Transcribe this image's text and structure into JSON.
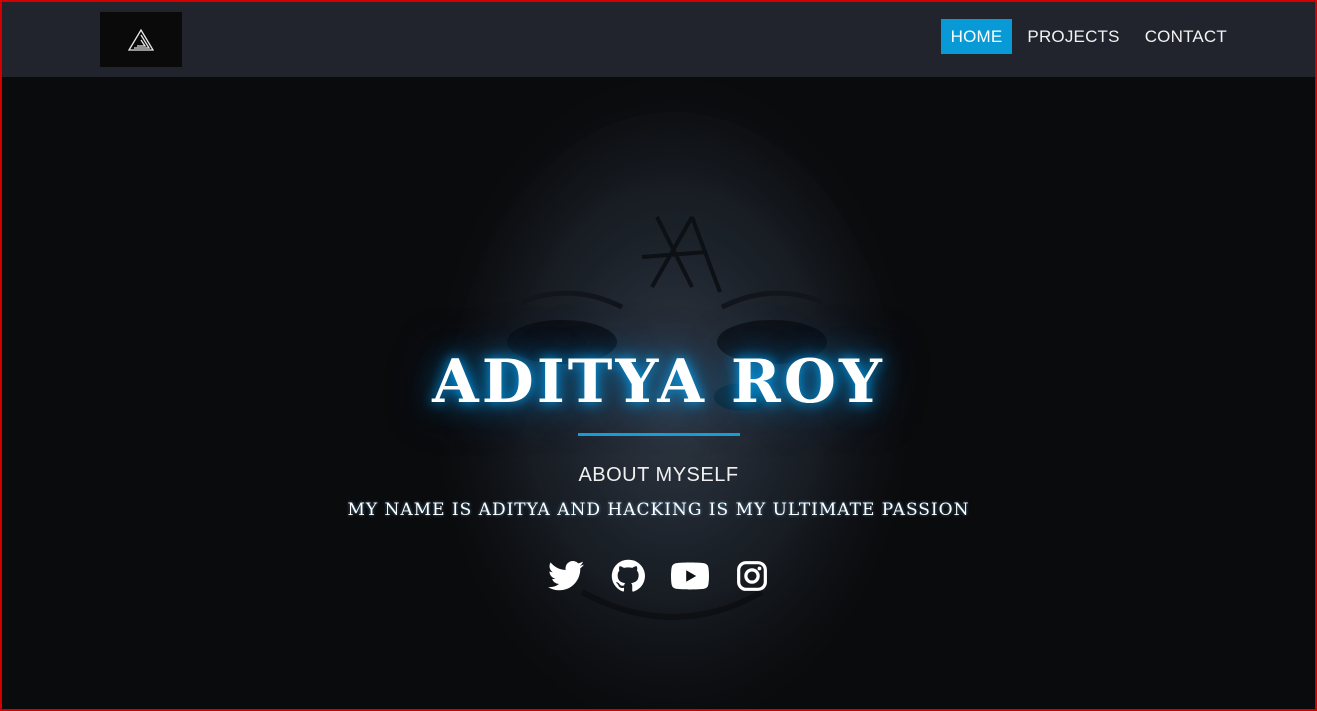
{
  "nav": {
    "items": [
      {
        "label": "HOME",
        "active": true
      },
      {
        "label": "PROJECTS",
        "active": false
      },
      {
        "label": "CONTACT",
        "active": false
      }
    ]
  },
  "logo": {
    "icon": "triangle-a-logo-icon"
  },
  "hero": {
    "name": "ADITYA ROY",
    "about_title": "ABOUT MYSELF",
    "about_text": "MY NAME IS ADITYA AND HACKING IS MY ULTIMATE PASSION"
  },
  "socials": [
    {
      "icon": "twitter-icon"
    },
    {
      "icon": "github-icon"
    },
    {
      "icon": "youtube-icon"
    },
    {
      "icon": "instagram-icon"
    }
  ],
  "colors": {
    "accent": "#079ad6",
    "navbar": "#21242c",
    "background": "#0a0b0d",
    "glow": "#00aaff",
    "frame_border": "#d40000"
  }
}
